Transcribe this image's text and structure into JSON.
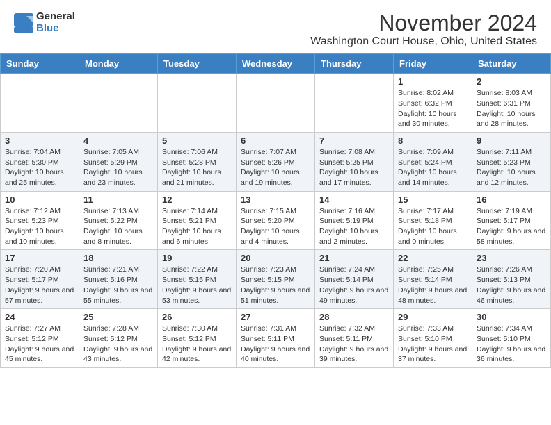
{
  "header": {
    "logo_general": "General",
    "logo_blue": "Blue",
    "title": "November 2024",
    "subtitle": "Washington Court House, Ohio, United States"
  },
  "weekdays": [
    "Sunday",
    "Monday",
    "Tuesday",
    "Wednesday",
    "Thursday",
    "Friday",
    "Saturday"
  ],
  "weeks": [
    [
      {
        "day": "",
        "info": ""
      },
      {
        "day": "",
        "info": ""
      },
      {
        "day": "",
        "info": ""
      },
      {
        "day": "",
        "info": ""
      },
      {
        "day": "",
        "info": ""
      },
      {
        "day": "1",
        "info": "Sunrise: 8:02 AM\nSunset: 6:32 PM\nDaylight: 10 hours and 30 minutes."
      },
      {
        "day": "2",
        "info": "Sunrise: 8:03 AM\nSunset: 6:31 PM\nDaylight: 10 hours and 28 minutes."
      }
    ],
    [
      {
        "day": "3",
        "info": "Sunrise: 7:04 AM\nSunset: 5:30 PM\nDaylight: 10 hours and 25 minutes."
      },
      {
        "day": "4",
        "info": "Sunrise: 7:05 AM\nSunset: 5:29 PM\nDaylight: 10 hours and 23 minutes."
      },
      {
        "day": "5",
        "info": "Sunrise: 7:06 AM\nSunset: 5:28 PM\nDaylight: 10 hours and 21 minutes."
      },
      {
        "day": "6",
        "info": "Sunrise: 7:07 AM\nSunset: 5:26 PM\nDaylight: 10 hours and 19 minutes."
      },
      {
        "day": "7",
        "info": "Sunrise: 7:08 AM\nSunset: 5:25 PM\nDaylight: 10 hours and 17 minutes."
      },
      {
        "day": "8",
        "info": "Sunrise: 7:09 AM\nSunset: 5:24 PM\nDaylight: 10 hours and 14 minutes."
      },
      {
        "day": "9",
        "info": "Sunrise: 7:11 AM\nSunset: 5:23 PM\nDaylight: 10 hours and 12 minutes."
      }
    ],
    [
      {
        "day": "10",
        "info": "Sunrise: 7:12 AM\nSunset: 5:23 PM\nDaylight: 10 hours and 10 minutes."
      },
      {
        "day": "11",
        "info": "Sunrise: 7:13 AM\nSunset: 5:22 PM\nDaylight: 10 hours and 8 minutes."
      },
      {
        "day": "12",
        "info": "Sunrise: 7:14 AM\nSunset: 5:21 PM\nDaylight: 10 hours and 6 minutes."
      },
      {
        "day": "13",
        "info": "Sunrise: 7:15 AM\nSunset: 5:20 PM\nDaylight: 10 hours and 4 minutes."
      },
      {
        "day": "14",
        "info": "Sunrise: 7:16 AM\nSunset: 5:19 PM\nDaylight: 10 hours and 2 minutes."
      },
      {
        "day": "15",
        "info": "Sunrise: 7:17 AM\nSunset: 5:18 PM\nDaylight: 10 hours and 0 minutes."
      },
      {
        "day": "16",
        "info": "Sunrise: 7:19 AM\nSunset: 5:17 PM\nDaylight: 9 hours and 58 minutes."
      }
    ],
    [
      {
        "day": "17",
        "info": "Sunrise: 7:20 AM\nSunset: 5:17 PM\nDaylight: 9 hours and 57 minutes."
      },
      {
        "day": "18",
        "info": "Sunrise: 7:21 AM\nSunset: 5:16 PM\nDaylight: 9 hours and 55 minutes."
      },
      {
        "day": "19",
        "info": "Sunrise: 7:22 AM\nSunset: 5:15 PM\nDaylight: 9 hours and 53 minutes."
      },
      {
        "day": "20",
        "info": "Sunrise: 7:23 AM\nSunset: 5:15 PM\nDaylight: 9 hours and 51 minutes."
      },
      {
        "day": "21",
        "info": "Sunrise: 7:24 AM\nSunset: 5:14 PM\nDaylight: 9 hours and 49 minutes."
      },
      {
        "day": "22",
        "info": "Sunrise: 7:25 AM\nSunset: 5:14 PM\nDaylight: 9 hours and 48 minutes."
      },
      {
        "day": "23",
        "info": "Sunrise: 7:26 AM\nSunset: 5:13 PM\nDaylight: 9 hours and 46 minutes."
      }
    ],
    [
      {
        "day": "24",
        "info": "Sunrise: 7:27 AM\nSunset: 5:12 PM\nDaylight: 9 hours and 45 minutes."
      },
      {
        "day": "25",
        "info": "Sunrise: 7:28 AM\nSunset: 5:12 PM\nDaylight: 9 hours and 43 minutes."
      },
      {
        "day": "26",
        "info": "Sunrise: 7:30 AM\nSunset: 5:12 PM\nDaylight: 9 hours and 42 minutes."
      },
      {
        "day": "27",
        "info": "Sunrise: 7:31 AM\nSunset: 5:11 PM\nDaylight: 9 hours and 40 minutes."
      },
      {
        "day": "28",
        "info": "Sunrise: 7:32 AM\nSunset: 5:11 PM\nDaylight: 9 hours and 39 minutes."
      },
      {
        "day": "29",
        "info": "Sunrise: 7:33 AM\nSunset: 5:10 PM\nDaylight: 9 hours and 37 minutes."
      },
      {
        "day": "30",
        "info": "Sunrise: 7:34 AM\nSunset: 5:10 PM\nDaylight: 9 hours and 36 minutes."
      }
    ]
  ]
}
